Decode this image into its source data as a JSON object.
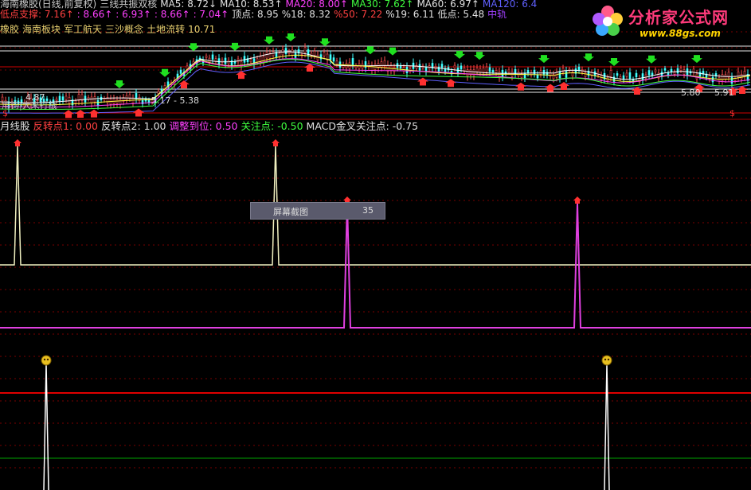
{
  "header": {
    "line1": [
      {
        "text": "海南橡胶(日线,前复权)",
        "color": "#c8c8c8"
      },
      {
        "text": "三线共振双核",
        "color": "#c8c8c8"
      },
      {
        "text": "MA5: 8.72↓",
        "color": "#e0e0e0"
      },
      {
        "text": "MA10: 8.53↑",
        "color": "#e0e0e0"
      },
      {
        "text": "MA20: 8.00↑",
        "color": "#ff40ff"
      },
      {
        "text": "MA30: 7.62↑",
        "color": "#40ff40"
      },
      {
        "text": "MA60: 6.97↑",
        "color": "#e0e0e0"
      },
      {
        "text": "MA120: 6.4",
        "color": "#6060ff"
      }
    ],
    "line2": [
      {
        "text": "低点支撑: 7.16↑",
        "color": "#ff4040"
      },
      {
        "text": ": 8.66↑",
        "color": "#ff40ff"
      },
      {
        "text": ": 6.93↑",
        "color": "#ff40ff"
      },
      {
        "text": ": 8.66↑",
        "color": "#ff40ff"
      },
      {
        "text": ": 7.04↑",
        "color": "#ff40ff"
      },
      {
        "text": "顶点: 8.95",
        "color": "#e0e0e0"
      },
      {
        "text": "%18: 8.32",
        "color": "#e0e0e0"
      },
      {
        "text": "%50: 7.22",
        "color": "#ff4040"
      },
      {
        "text": "%19: 6.11",
        "color": "#e0e0e0"
      },
      {
        "text": "低点: 5.48",
        "color": "#e0e0e0"
      },
      {
        "text": "中轨",
        "color": "#a040ff"
      }
    ],
    "line3": [
      {
        "text": "橡胶",
        "color": "#e8d070"
      },
      {
        "text": "海南板块",
        "color": "#e8d070"
      },
      {
        "text": "军工航天",
        "color": "#e8d070"
      },
      {
        "text": "三沙概念",
        "color": "#e8d070"
      },
      {
        "text": "土地流转",
        "color": "#e8d070"
      },
      {
        "text": "10.71",
        "color": "#e8d070"
      }
    ]
  },
  "indicator_header": [
    {
      "text": "月线股",
      "color": "#e0e0e0"
    },
    {
      "text": "反转点1: 0.00",
      "color": "#ff4040"
    },
    {
      "text": "反转点2: 1.00",
      "color": "#e0e0e0"
    },
    {
      "text": "调整到位: 0.50",
      "color": "#ff40ff"
    },
    {
      "text": "关注点: -0.50",
      "color": "#40ff40"
    },
    {
      "text": "MACD金叉关注点: -0.75",
      "color": "#e0e0e0"
    }
  ],
  "price_labels": {
    "left_low": "4.87",
    "mid_range": "5.17 - 5.38",
    "right_1": "5.80",
    "right_2": "5.91",
    "left_text": "用钩|大来打战"
  },
  "logo": {
    "title": "分析家公式网",
    "url": "www.88gs.com"
  },
  "tooltip": {
    "label": "屏幕截图",
    "value": "35"
  },
  "colors": {
    "bg": "#000000",
    "grid_red": "#7a0000",
    "signal_yellow": "#f0f0c0",
    "signal_magenta": "#e040e0",
    "bright_red": "#e00000",
    "green_line": "#00a000",
    "white": "#ffffff"
  }
}
